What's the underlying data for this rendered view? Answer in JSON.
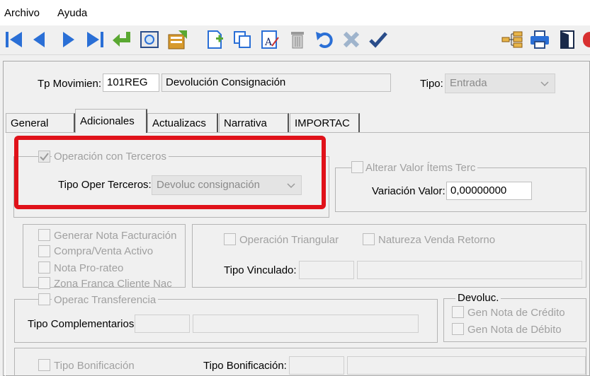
{
  "menu": {
    "archivo": "Archivo",
    "ayuda": "Ayuda"
  },
  "toolbar": {
    "icons": [
      "first-record-icon",
      "prev-record-icon",
      "next-record-icon",
      "last-record-icon",
      "enter-icon",
      "preview-icon",
      "edit-icon",
      "new-document-icon",
      "copy-icon",
      "rename-icon",
      "trash-icon",
      "undo-icon",
      "cancel-icon",
      "confirm-icon",
      "tree-icon",
      "print-icon",
      "exit-door-icon"
    ],
    "colors": {
      "blue": "#2a6fd6",
      "green": "#5aa832",
      "gray": "#8a8a8a"
    }
  },
  "header": {
    "tp_label": "Tp Movimien:",
    "tp_code": "101REG",
    "tp_desc": "Devolución Consignación",
    "tipo_label": "Tipo:",
    "tipo_value": "Entrada"
  },
  "tabs": [
    {
      "label": "General"
    },
    {
      "label": "Adicionales"
    },
    {
      "label": "Actualizacs"
    },
    {
      "label": "Narrativa"
    },
    {
      "label": "IMPORTAC"
    }
  ],
  "terceros": {
    "check_label": "Operación con Terceros",
    "checked": true,
    "tipo_label": "Tipo Oper Terceros:",
    "tipo_value": "Devoluc consignación"
  },
  "alterar": {
    "check_label": "Alterar Valor Ítems Terc",
    "variacion_label": "Variación Valor:",
    "variacion_value": "0,00000000"
  },
  "options": {
    "generar": "Generar Nota Facturación",
    "compra": "Compra/Venta Activo",
    "nota": "Nota Pro-rateo",
    "zona": "Zona Franca Cliente Nac"
  },
  "triangular": {
    "operacion": "Operación Triangular",
    "natureza": "Natureza Venda Retorno",
    "vinculado_label": "Tipo Vinculado:"
  },
  "transferencia": {
    "check_label": "Operac Transferencia",
    "comp_label": "Tipo Complementarios:"
  },
  "devoluc": {
    "legend": "Devoluc.",
    "credito": "Gen Nota de Crédito",
    "debito": "Gen Nota de Débito"
  },
  "bonificacion": {
    "check_label": "Tipo Bonificación",
    "field_label": "Tipo Bonificación:"
  }
}
